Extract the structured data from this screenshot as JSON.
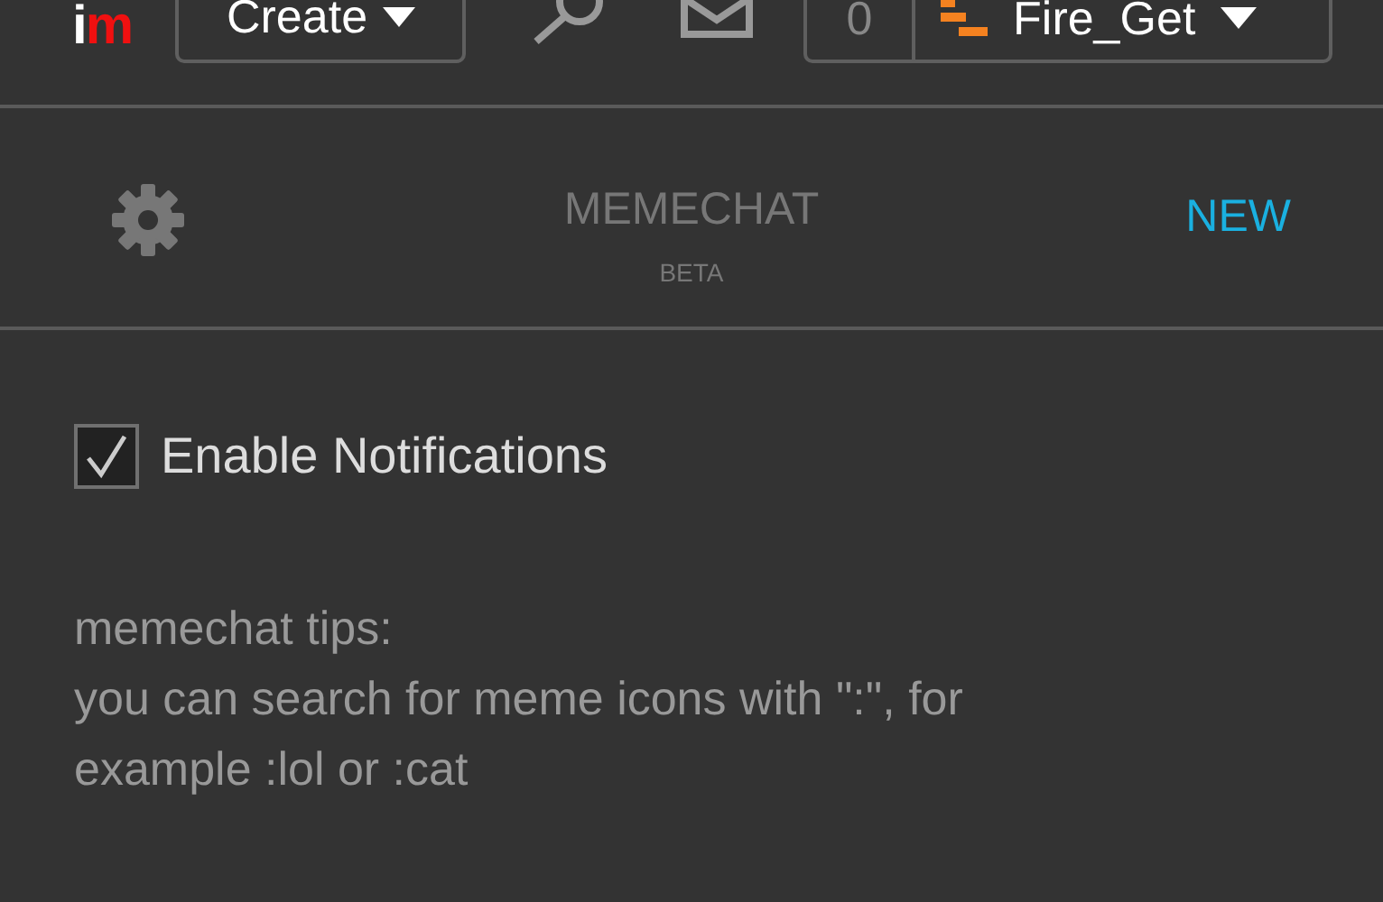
{
  "topbar": {
    "logo": [
      "i",
      "m"
    ],
    "create_button": "Create",
    "notification_count": "0",
    "username": "Fire_Get"
  },
  "header": {
    "title": "MEMECHAT",
    "subtitle": "BETA",
    "new_button": "NEW"
  },
  "notifications": {
    "label": "Enable Notifications",
    "checked": true
  },
  "tips": {
    "heading": "memechat tips:",
    "text": "you can search for meme icons with \":\", for example :lol or :cat"
  }
}
